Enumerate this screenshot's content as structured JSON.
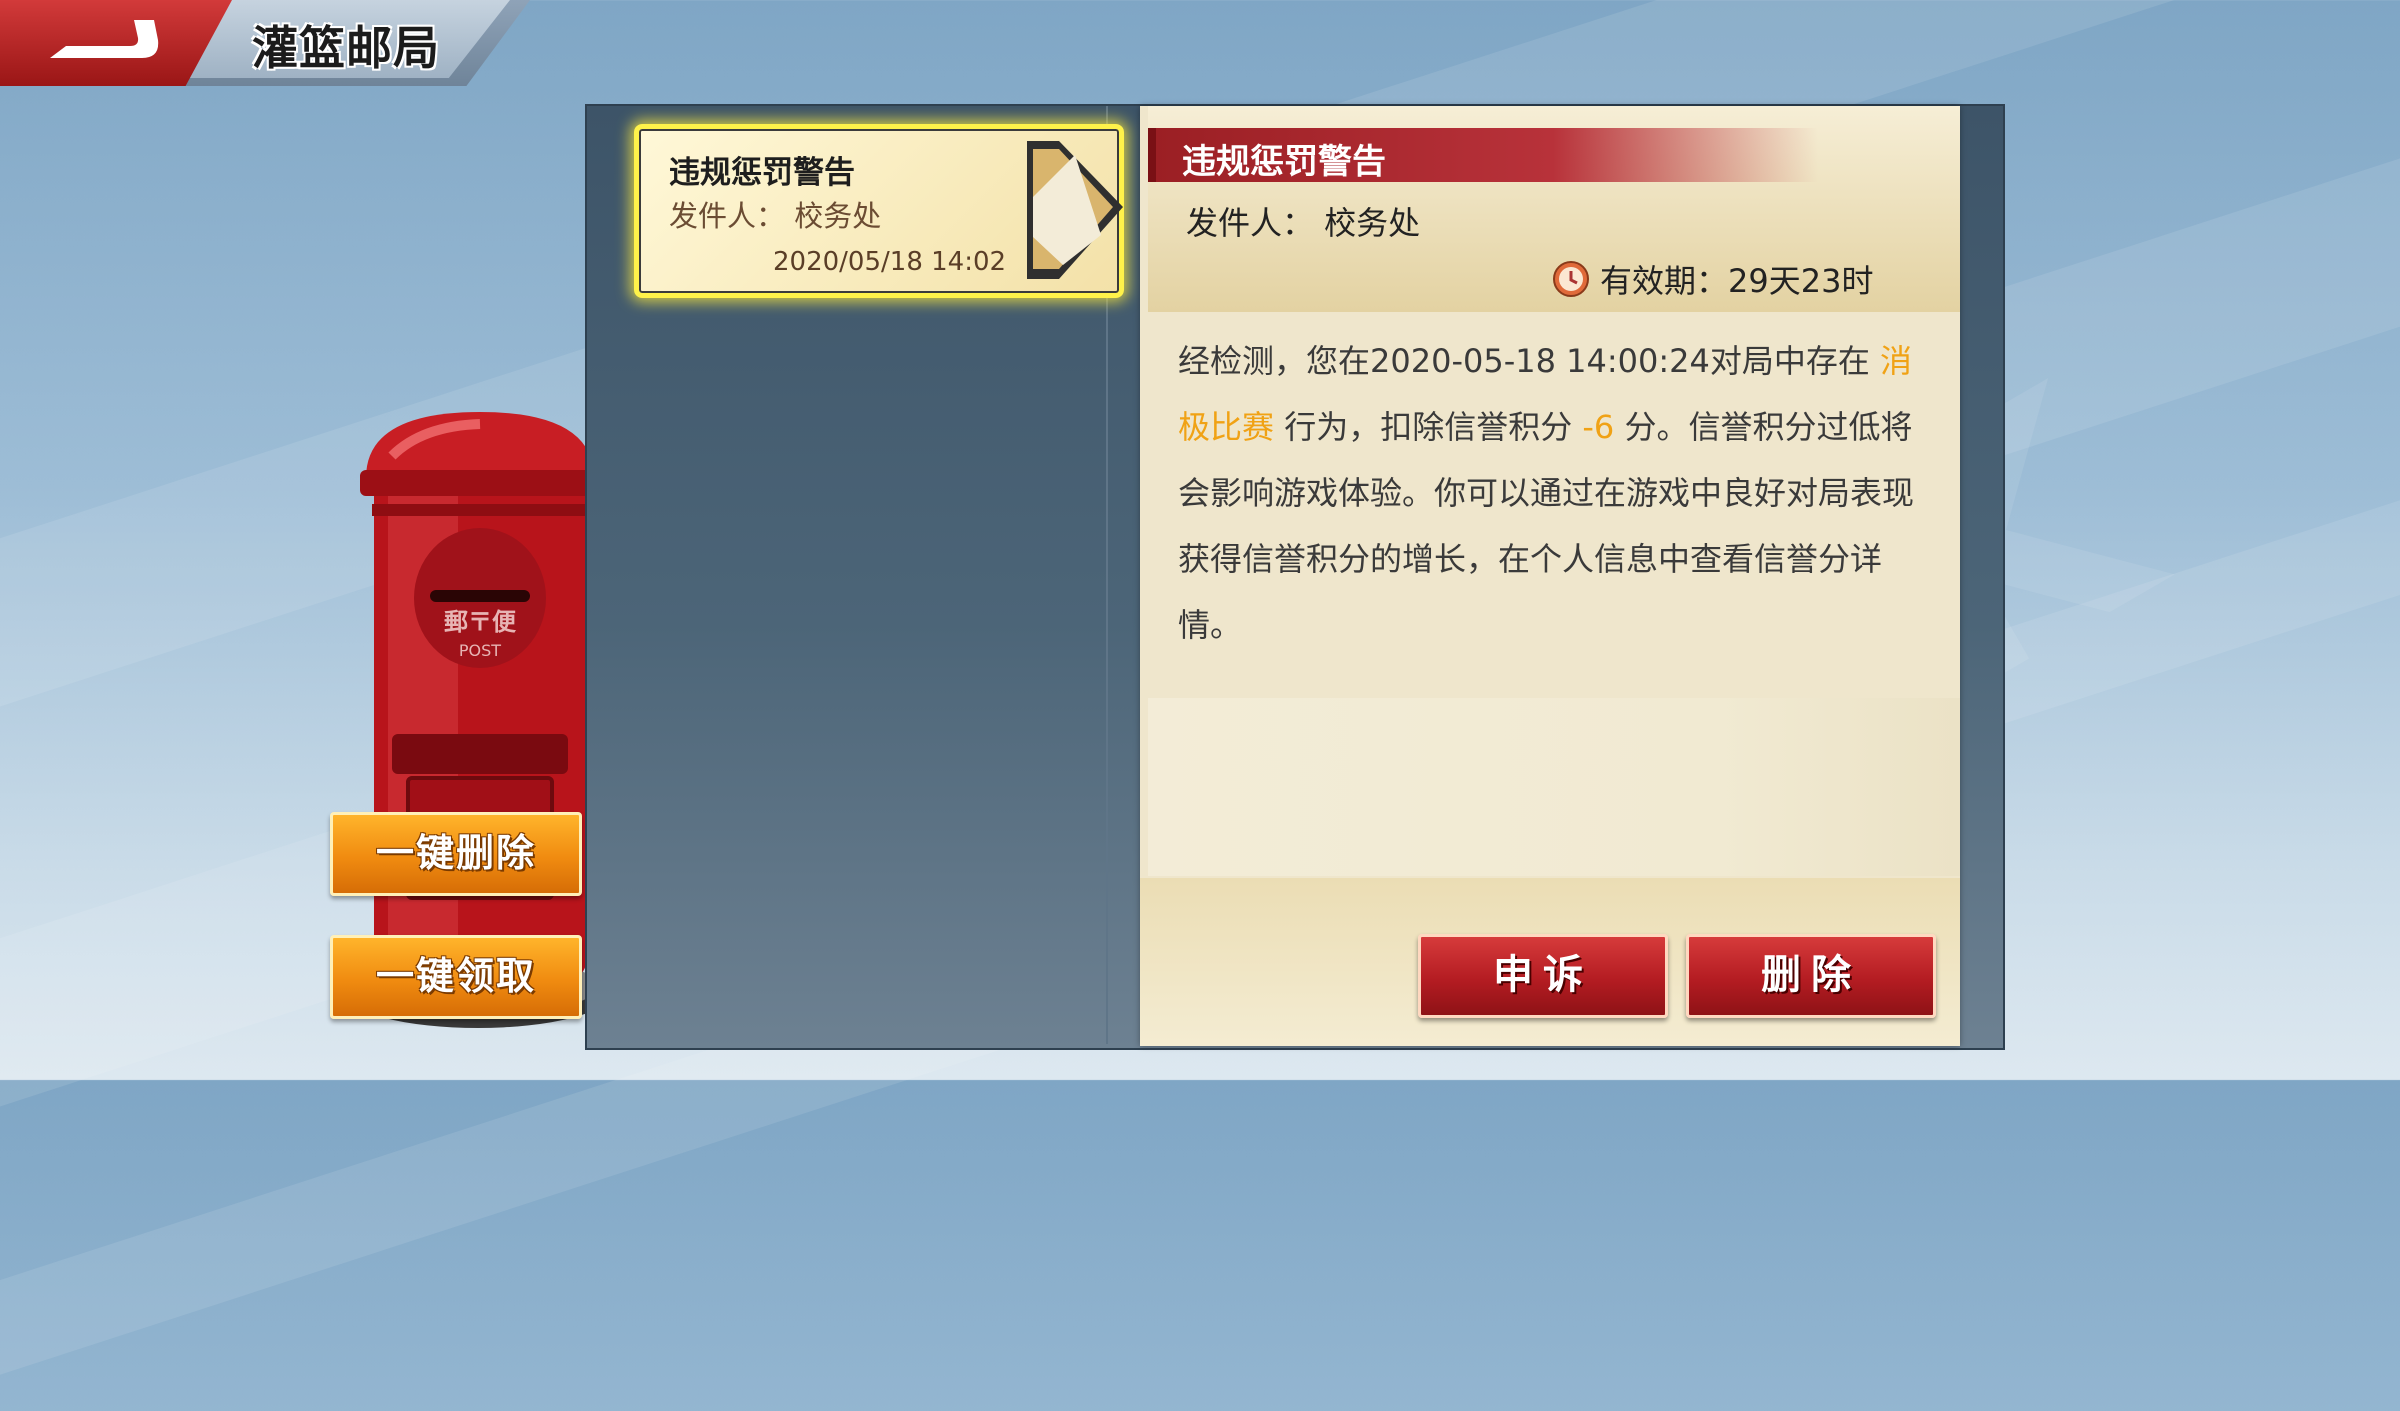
{
  "header": {
    "title": "灌篮邮局"
  },
  "side_buttons": {
    "delete_all": "一键删除",
    "claim_all": "一键领取"
  },
  "mail_list": [
    {
      "title": "违规惩罚警告",
      "sender": "发件人： 校务处",
      "date": "2020/05/18 14:02"
    }
  ],
  "mailbox": {
    "plate_text": "郵〒便",
    "post_text": "POST"
  },
  "detail": {
    "title": "违规惩罚警告",
    "sender": "发件人： 校务处",
    "validity": "有效期：29天23时",
    "body_part1": "经检测，您在2020-05-18 14:00:24对局中存在 ",
    "body_highlight1": "消极比赛",
    "body_part2": " 行为，扣除信誉积分 ",
    "body_highlight2": "-6",
    "body_part3": " 分。信誉积分过低将会影响游戏体验。你可以通过在游戏中良好对局表现获得信誉积分的增长，在个人信息中查看信誉分详情。",
    "appeal_button": "申诉",
    "delete_button": "删除"
  },
  "colors": {
    "highlight": "#f0a215",
    "title_bar": "#9b1f24",
    "orange_button": "#f08b10",
    "red_button": "#b41c22"
  }
}
